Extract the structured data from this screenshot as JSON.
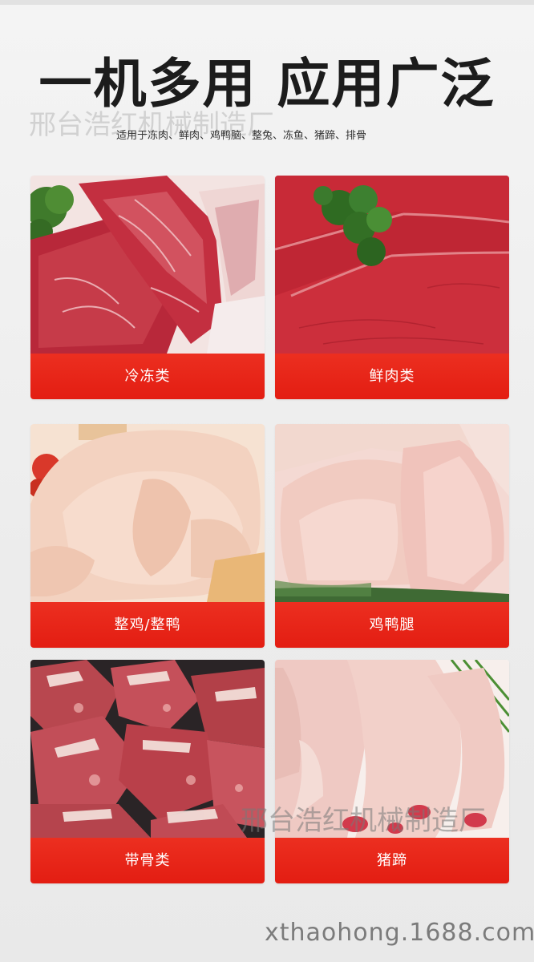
{
  "header": {
    "title": "一机多用 应用广泛",
    "subtitle": "适用于冻肉、鲜肉、鸡鸭脑、整兔、冻鱼、猪蹄、排骨"
  },
  "watermarks": {
    "top": "邢台浩红机械制造厂",
    "middle": "邢台浩红机械制造厂",
    "bottom": "xthaohong.1688.com"
  },
  "cards": [
    {
      "label": "冷冻类",
      "image": "frozen-marbled-beef-slices"
    },
    {
      "label": "鲜肉类",
      "image": "fresh-beef-with-parsley"
    },
    {
      "label": "整鸡/整鸭",
      "image": "whole-raw-chicken"
    },
    {
      "label": "鸡鸭腿",
      "image": "raw-chicken-legs"
    },
    {
      "label": "带骨类",
      "image": "bone-in-meat-chunks"
    },
    {
      "label": "猪蹄",
      "image": "raw-pig-trotters"
    }
  ],
  "colors": {
    "accent": "#e31d12",
    "title": "#1c1c1c",
    "background": "#efefef"
  }
}
